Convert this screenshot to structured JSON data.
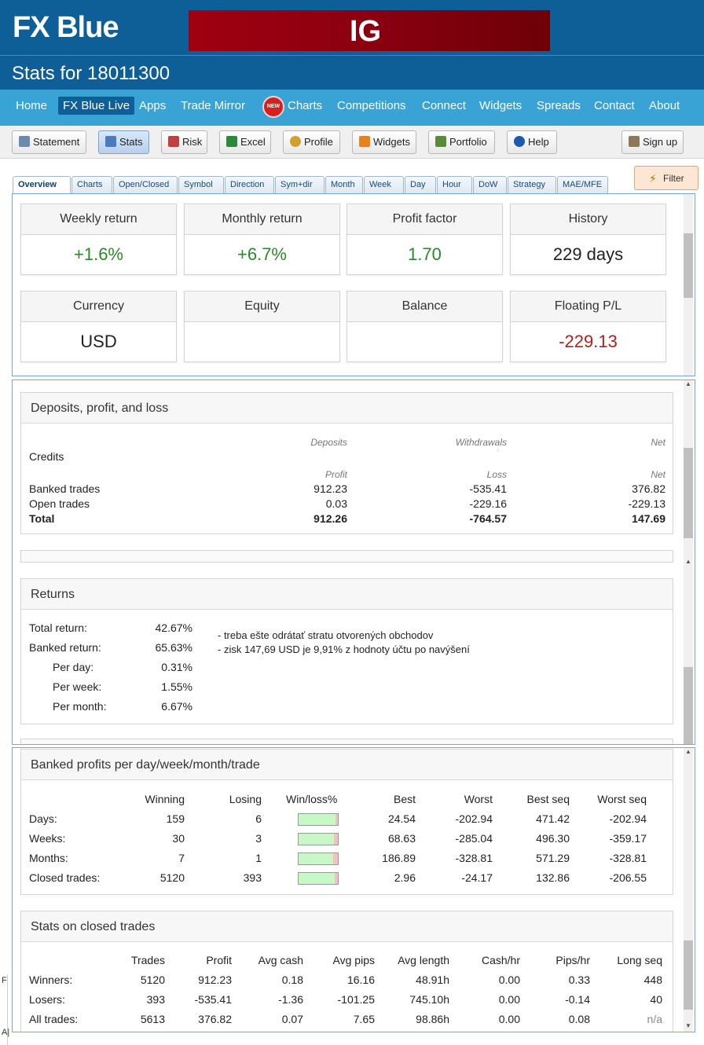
{
  "brand": {
    "logo": "FX Blue",
    "ad_text": "IG",
    "accent": "#0e5f97",
    "nav_bg": "#3aa3d6"
  },
  "title": "Stats for 18011300",
  "nav": {
    "items": [
      "Home",
      "FX Blue Live",
      "Apps",
      "Trade Mirror",
      "Charts",
      "Competitions",
      "Connect",
      "Widgets",
      "Spreads",
      "Contact",
      "About"
    ],
    "active": "FX Blue Live",
    "badge": "NEW"
  },
  "toolbar": {
    "statement": "Statement",
    "stats": "Stats",
    "risk": "Risk",
    "excel": "Excel",
    "profile": "Profile",
    "widgets": "Widgets",
    "portfolio": "Portfolio",
    "help": "Help",
    "signup": "Sign up"
  },
  "tabs": [
    "Overview",
    "Charts",
    "Open/Closed",
    "Symbol",
    "Direction",
    "Sym+dir",
    "Month",
    "Week",
    "Day",
    "Hour",
    "DoW",
    "Strategy",
    "MAE/MFE"
  ],
  "filter": "Filter",
  "kpis": [
    {
      "label": "Weekly return",
      "value": "+1.6%",
      "tone": "green"
    },
    {
      "label": "Monthly return",
      "value": "+6.7%",
      "tone": "green"
    },
    {
      "label": "Profit factor",
      "value": "1.70",
      "tone": "green"
    },
    {
      "label": "History",
      "value": "229 days",
      "tone": "normal"
    },
    {
      "label": "Currency",
      "value": "USD",
      "tone": "normal"
    },
    {
      "label": "Equity",
      "value": "",
      "tone": "normal"
    },
    {
      "label": "Balance",
      "value": "",
      "tone": "normal"
    },
    {
      "label": "Floating P/L",
      "value": "-229.13",
      "tone": "red"
    }
  ],
  "deposits": {
    "title": "Deposits, profit, and loss",
    "head1": [
      "Deposits",
      "Withdrawals",
      "Net"
    ],
    "credits": "Credits",
    "credits_dot": ".",
    "head2": [
      "Profit",
      "Loss",
      "Net"
    ],
    "rows": [
      {
        "label": "Banked trades",
        "profit": "912.23",
        "loss": "-535.41",
        "net": "376.82"
      },
      {
        "label": "Open trades",
        "profit": "0.03",
        "loss": "-229.16",
        "net": "-229.13"
      },
      {
        "label": "Total",
        "profit": "912.26",
        "loss": "-764.57",
        "net": "147.69"
      }
    ]
  },
  "returns": {
    "title": "Returns",
    "rows": [
      {
        "label": "Total return:",
        "value": "42.67%"
      },
      {
        "label": "Banked return:",
        "value": "65.63%"
      },
      {
        "label": "Per day:",
        "value": "0.31%"
      },
      {
        "label": "Per week:",
        "value": "1.55%"
      },
      {
        "label": "Per month:",
        "value": "6.67%"
      }
    ],
    "notes": [
      "- treba ešte odrátať stratu otvorených obchodov",
      "- zisk 147,69 USD je 9,91% z hodnoty účtu po navýšení"
    ]
  },
  "banked": {
    "title": "Banked profits per day/week/month/trade",
    "headers": [
      "Winning",
      "Losing",
      "Win/loss%",
      "Best",
      "Worst",
      "Best seq",
      "Worst seq"
    ],
    "rows": [
      {
        "label": "Days:",
        "win": "159",
        "lose": "6",
        "loss_frac": 0.036,
        "best": "24.54",
        "worst": "-202.94",
        "bestseq": "471.42",
        "worstseq": "-202.94"
      },
      {
        "label": "Weeks:",
        "win": "30",
        "lose": "3",
        "loss_frac": 0.09,
        "best": "68.63",
        "worst": "-285.04",
        "bestseq": "496.30",
        "worstseq": "-359.17"
      },
      {
        "label": "Months:",
        "win": "7",
        "lose": "1",
        "loss_frac": 0.125,
        "best": "186.89",
        "worst": "-328.81",
        "bestseq": "571.29",
        "worstseq": "-328.81"
      },
      {
        "label": "Closed trades:",
        "win": "5120",
        "lose": "393",
        "loss_frac": 0.07,
        "best": "2.96",
        "worst": "-24.17",
        "bestseq": "132.86",
        "worstseq": "-206.55"
      }
    ]
  },
  "closed": {
    "title": "Stats on closed trades",
    "headers": [
      "Trades",
      "Profit",
      "Avg cash",
      "Avg pips",
      "Avg length",
      "Cash/hr",
      "Pips/hr",
      "Long seq"
    ],
    "rows": [
      {
        "label": "Winners:",
        "cells": [
          "5120",
          "912.23",
          "0.18",
          "16.16",
          "48.91h",
          "0.00",
          "0.33",
          "448"
        ]
      },
      {
        "label": "Losers:",
        "cells": [
          "393",
          "-535.41",
          "-1.36",
          "-101.25",
          "745.10h",
          "0.00",
          "-0.14",
          "40"
        ]
      },
      {
        "label": "All trades:",
        "cells": [
          "5613",
          "376.82",
          "0.07",
          "7.65",
          "98.86h",
          "0.00",
          "0.08",
          "n/a"
        ]
      }
    ]
  },
  "left_strip": [
    "F",
    "A|"
  ]
}
